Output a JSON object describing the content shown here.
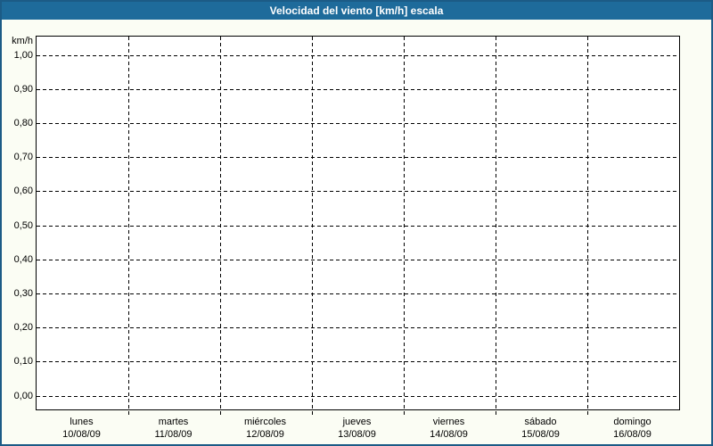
{
  "window": {
    "colors": {
      "header_bg": "#1e6b9b",
      "border_color": "#1c5b86",
      "page_bg": "#fbfdf4",
      "plot_bg": "#ffffff",
      "grid_color": "#000000",
      "text_color": "#000000",
      "title_color": "#ffffff"
    }
  },
  "chart_data": {
    "type": "line",
    "title": "Velocidad del viento [km/h] escala",
    "ylabel": "km/h",
    "xlabel": "",
    "ylim": [
      0,
      1
    ],
    "y_tick_step": 0.1,
    "y_tick_labels": [
      "0,00",
      "0,10",
      "0,20",
      "0,30",
      "0,40",
      "0,50",
      "0,60",
      "0,70",
      "0,80",
      "0,90",
      "1,00"
    ],
    "x_tick_labels": [
      {
        "day": "lunes",
        "date": "10/08/09"
      },
      {
        "day": "martes",
        "date": "11/08/09"
      },
      {
        "day": "miércoles",
        "date": "12/08/09"
      },
      {
        "day": "jueves",
        "date": "13/08/09"
      },
      {
        "day": "viernes",
        "date": "14/08/09"
      },
      {
        "day": "sábado",
        "date": "15/08/09"
      },
      {
        "day": "domingo",
        "date": "16/08/09"
      }
    ],
    "grid": true,
    "grid_style": "dashed",
    "legend": false,
    "series": []
  }
}
